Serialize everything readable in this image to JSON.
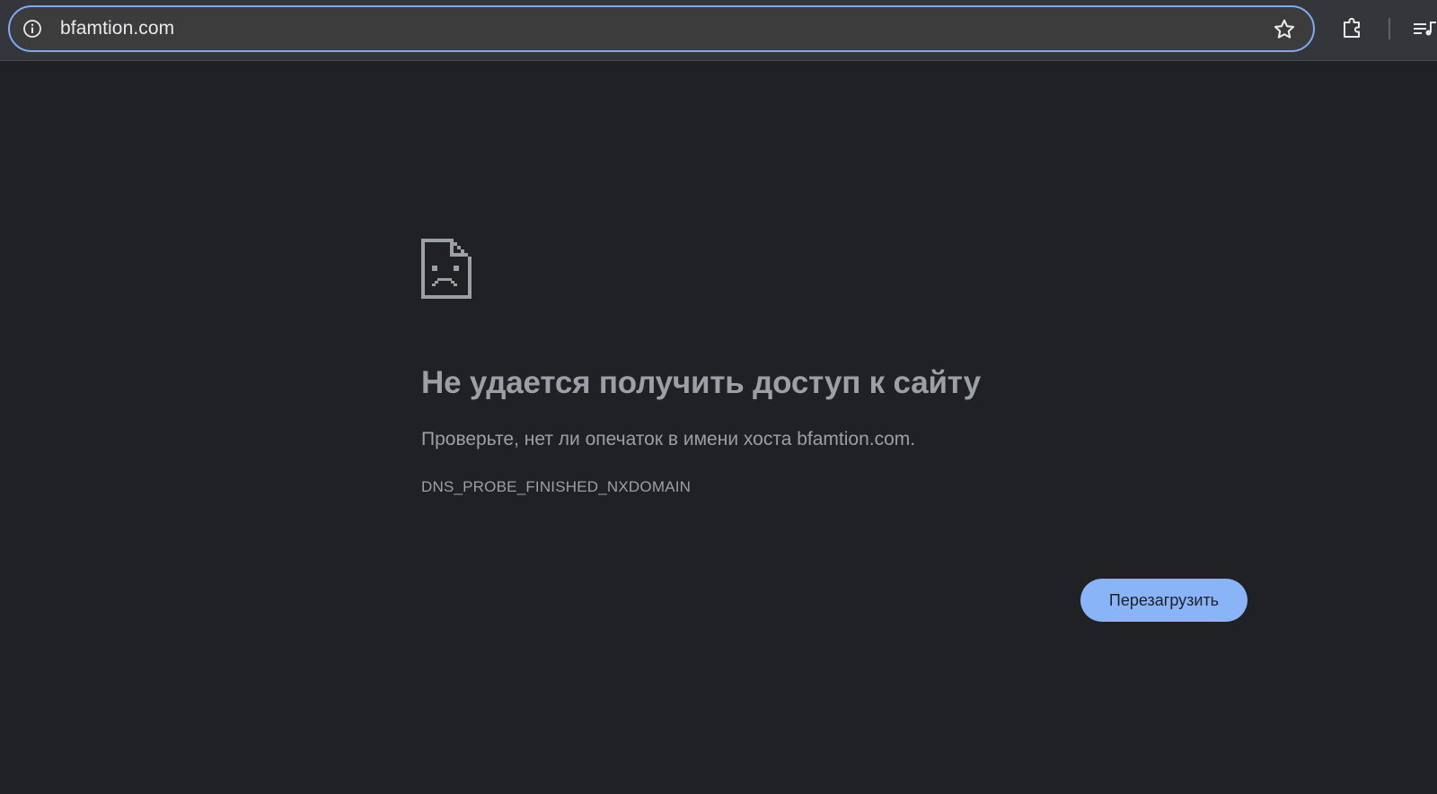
{
  "browser": {
    "url": "bfamtion.com",
    "site_info_icon": "info-circle-icon",
    "bookmark_icon": "star-outline-icon",
    "extensions_icon": "puzzle-piece-icon",
    "media_icon": "media-queue-icon"
  },
  "error_page": {
    "icon": "sad-page-icon",
    "title": "Не удается получить доступ к сайту",
    "description": "Проверьте, нет ли опечаток в имени хоста bfamtion.com.",
    "error_code": "DNS_PROBE_FINISHED_NXDOMAIN",
    "reload_label": "Перезагрузить"
  },
  "colors": {
    "background": "#202124",
    "toolbar": "#35363a",
    "omnibox_border": "#7cacf8",
    "text_secondary": "#9aa0a6",
    "button": "#8ab4f8"
  }
}
